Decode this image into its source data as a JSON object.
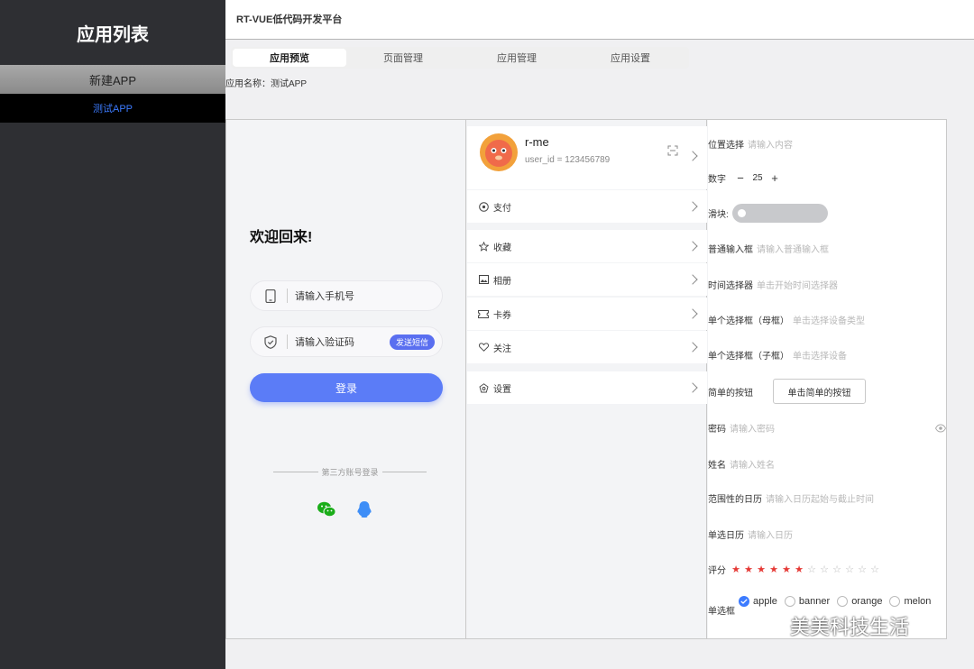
{
  "sidebar": {
    "title": "应用列表",
    "new_app": "新建APP",
    "apps": [
      "测试APP"
    ]
  },
  "header": {
    "title": "RT-VUE低代码开发平台"
  },
  "tabs": [
    {
      "label": "应用预览",
      "active": true
    },
    {
      "label": "页面管理",
      "active": false
    },
    {
      "label": "应用管理",
      "active": false
    },
    {
      "label": "应用设置",
      "active": false
    }
  ],
  "app_name": {
    "label": "应用名称：",
    "value": "测试APP"
  },
  "login": {
    "welcome": "欢迎回来!",
    "phone_placeholder": "请输入手机号",
    "code_placeholder": "请输入验证码",
    "send_code": "发送短信",
    "submit": "登录",
    "third_party": "第三方账号登录"
  },
  "profile": {
    "username": "r-me",
    "user_id": "user_id = 123456789",
    "menu": [
      "支付",
      "收藏",
      "相册",
      "卡券",
      "关注",
      "设置"
    ]
  },
  "form": {
    "position": {
      "label": "位置选择",
      "placeholder": "请输入内容"
    },
    "number": {
      "label": "数字",
      "value": "25",
      "minus": "−",
      "plus": "+"
    },
    "slider": {
      "label": "滑块:",
      "value": 0
    },
    "input": {
      "label": "普通输入框",
      "placeholder": "请输入普通输入框"
    },
    "time": {
      "label": "时间选择器",
      "placeholder": "单击开始时间选择器"
    },
    "select_parent": {
      "label": "单个选择框（母框）",
      "placeholder": "单击选择设备类型"
    },
    "select_child": {
      "label": "单个选择框（子框）",
      "placeholder": "单击选择设备"
    },
    "button": {
      "label": "简单的按钮",
      "text": "单击简单的按钮"
    },
    "password": {
      "label": "密码",
      "placeholder": "请输入密码"
    },
    "name": {
      "label": "姓名",
      "placeholder": "请输入姓名"
    },
    "range_calendar": {
      "label": "范围性的日历",
      "placeholder": "请输入日历起始与截止时间"
    },
    "calendar": {
      "label": "单选日历",
      "placeholder": "请输入日历"
    },
    "rating": {
      "label": "评分",
      "value": 6,
      "max": 12
    },
    "radio": {
      "label": "单选框",
      "options": [
        "apple",
        "banner",
        "orange",
        "melon"
      ],
      "selected": "apple"
    }
  },
  "watermark": "美美科技生活",
  "colors": {
    "primary": "#5b7cf7",
    "sidebar": "#2e2f33",
    "link": "#3c7bff",
    "star": "#e53935"
  }
}
